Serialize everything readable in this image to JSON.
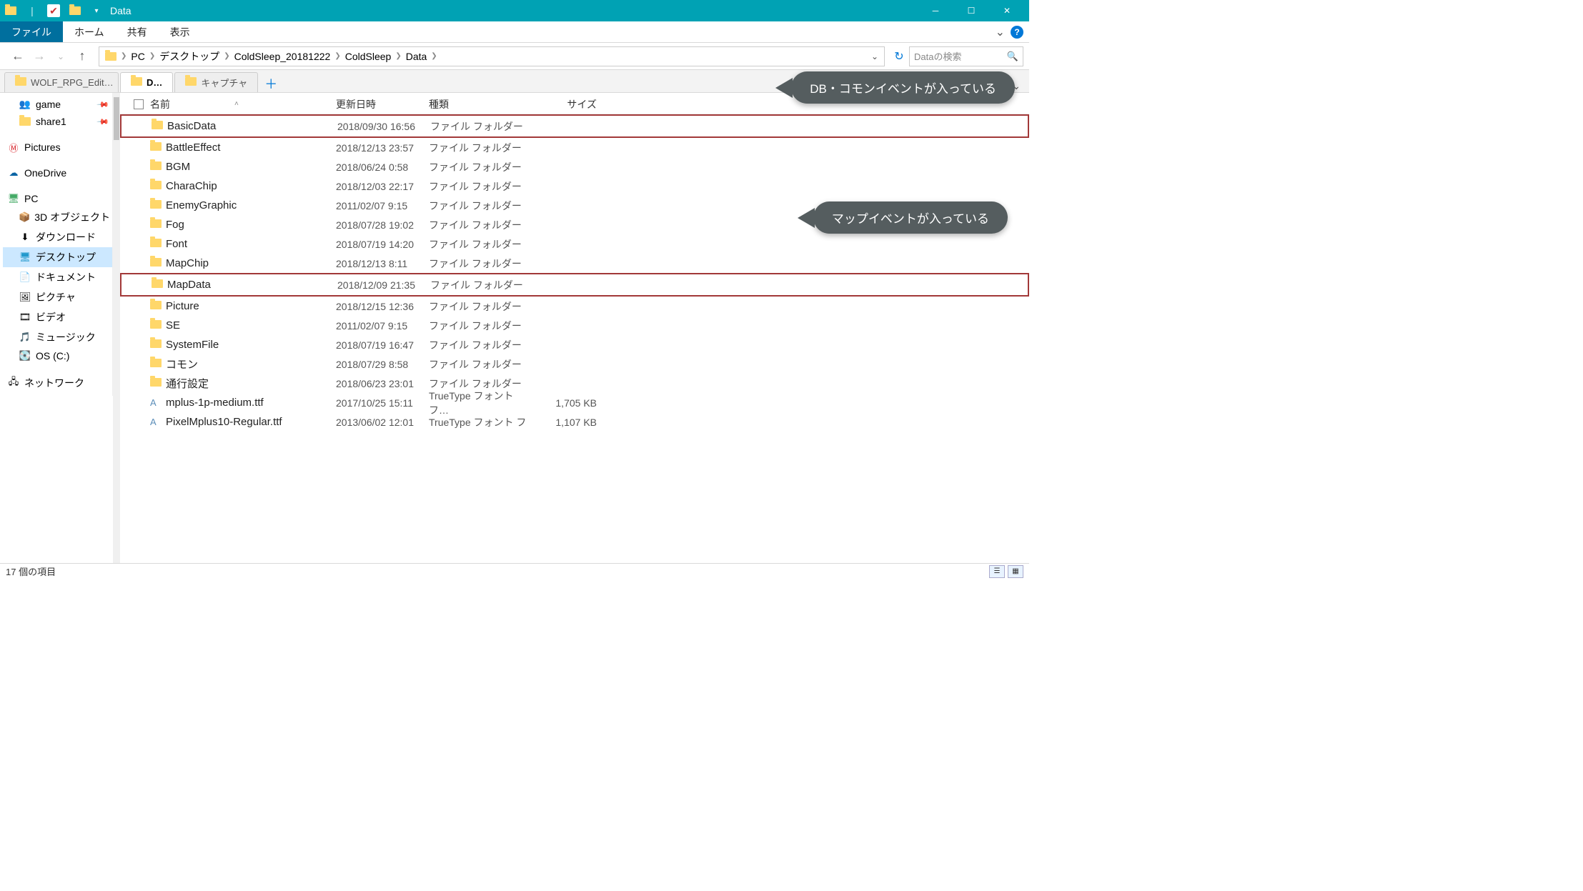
{
  "window": {
    "title": "Data"
  },
  "ribbon": {
    "file": "ファイル",
    "home": "ホーム",
    "share": "共有",
    "view": "表示"
  },
  "breadcrumb": [
    "PC",
    "デスクトップ",
    "ColdSleep_20181222",
    "ColdSleep",
    "Data"
  ],
  "search": {
    "placeholder": "Dataの検索"
  },
  "doctabs": [
    {
      "label": "WOLF_RPG_Edit…",
      "active": false
    },
    {
      "label": "D…",
      "active": true
    },
    {
      "label": "キャプチャ",
      "active": false
    }
  ],
  "columns": {
    "name": "名前",
    "date": "更新日時",
    "type": "種類",
    "size": "サイズ"
  },
  "nav": {
    "game": "game",
    "share1": "share1",
    "pictures": "Pictures",
    "onedrive": "OneDrive",
    "pc": "PC",
    "objects3d": "3D オブジェクト",
    "downloads": "ダウンロード",
    "desktop": "デスクトップ",
    "documents": "ドキュメント",
    "picturesLib": "ピクチャ",
    "videos": "ビデオ",
    "music": "ミュージック",
    "osdrive": "OS (C:)",
    "network": "ネットワーク"
  },
  "files": [
    {
      "name": "BasicData",
      "date": "2018/09/30 16:56",
      "type": "ファイル フォルダー",
      "kind": "folder",
      "highlight": true
    },
    {
      "name": "BattleEffect",
      "date": "2018/12/13 23:57",
      "type": "ファイル フォルダー",
      "kind": "folder"
    },
    {
      "name": "BGM",
      "date": "2018/06/24 0:58",
      "type": "ファイル フォルダー",
      "kind": "folder"
    },
    {
      "name": "CharaChip",
      "date": "2018/12/03 22:17",
      "type": "ファイル フォルダー",
      "kind": "folder"
    },
    {
      "name": "EnemyGraphic",
      "date": "2011/02/07 9:15",
      "type": "ファイル フォルダー",
      "kind": "folder"
    },
    {
      "name": "Fog",
      "date": "2018/07/28 19:02",
      "type": "ファイル フォルダー",
      "kind": "folder"
    },
    {
      "name": "Font",
      "date": "2018/07/19 14:20",
      "type": "ファイル フォルダー",
      "kind": "folder"
    },
    {
      "name": "MapChip",
      "date": "2018/12/13 8:11",
      "type": "ファイル フォルダー",
      "kind": "folder"
    },
    {
      "name": "MapData",
      "date": "2018/12/09 21:35",
      "type": "ファイル フォルダー",
      "kind": "folder",
      "highlight": true
    },
    {
      "name": "Picture",
      "date": "2018/12/15 12:36",
      "type": "ファイル フォルダー",
      "kind": "folder"
    },
    {
      "name": "SE",
      "date": "2011/02/07 9:15",
      "type": "ファイル フォルダー",
      "kind": "folder"
    },
    {
      "name": "SystemFile",
      "date": "2018/07/19 16:47",
      "type": "ファイル フォルダー",
      "kind": "folder"
    },
    {
      "name": "コモン",
      "date": "2018/07/29 8:58",
      "type": "ファイル フォルダー",
      "kind": "folder"
    },
    {
      "name": "通行設定",
      "date": "2018/06/23 23:01",
      "type": "ファイル フォルダー",
      "kind": "folder"
    },
    {
      "name": "mplus-1p-medium.ttf",
      "date": "2017/10/25 15:11",
      "type": "TrueType フォント フ…",
      "kind": "file",
      "size": "1,705 KB"
    },
    {
      "name": "PixelMplus10-Regular.ttf",
      "date": "2013/06/02 12:01",
      "type": "TrueType フォント フ",
      "kind": "file",
      "size": "1,107 KB"
    }
  ],
  "status": {
    "count": "17 個の項目"
  },
  "callouts": {
    "c1": "DB・コモンイベントが入っている",
    "c2": "マップイベントが入っている"
  }
}
